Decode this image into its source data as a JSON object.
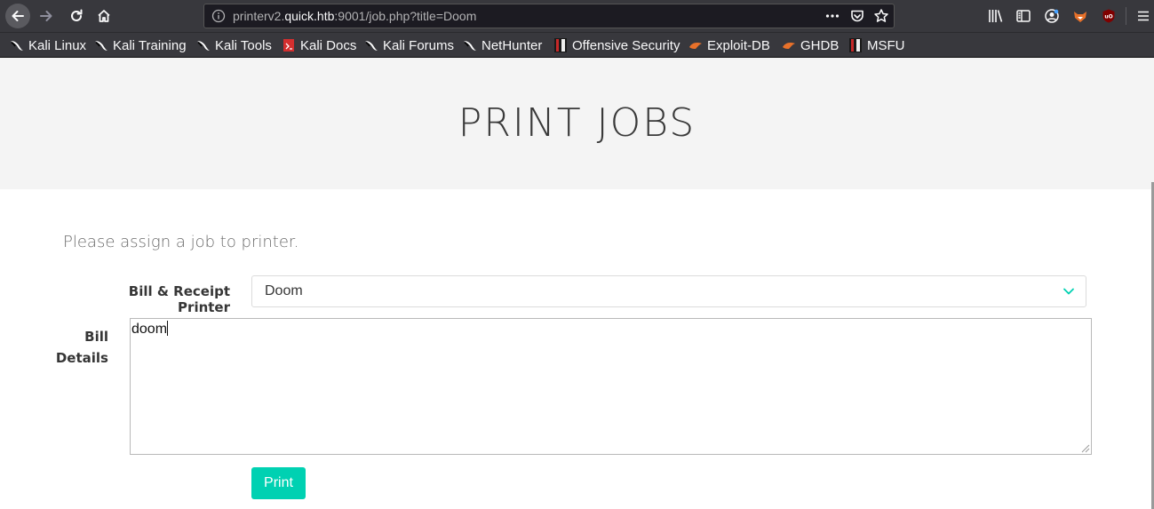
{
  "browser": {
    "url": {
      "prefix": "printerv2.",
      "host": "quick.htb",
      "suffix": ":9001/job.php?title=Doom"
    },
    "bookmarks": [
      {
        "label": "Kali Linux",
        "icon": "kali-dragon-icon"
      },
      {
        "label": "Kali Training",
        "icon": "kali-dragon-icon"
      },
      {
        "label": "Kali Tools",
        "icon": "kali-dragon-icon"
      },
      {
        "label": "Kali Docs",
        "icon": "kali-docs-icon"
      },
      {
        "label": "Kali Forums",
        "icon": "kali-dragon-icon"
      },
      {
        "label": "NetHunter",
        "icon": "kali-dragon-icon"
      },
      {
        "label": "Offensive Security",
        "icon": "offsec-icon"
      },
      {
        "label": "Exploit-DB",
        "icon": "exploitdb-icon"
      },
      {
        "label": "GHDB",
        "icon": "exploitdb-icon"
      },
      {
        "label": "MSFU",
        "icon": "offsec-icon"
      }
    ]
  },
  "page": {
    "title": "PRINT JOBS",
    "intro": "Please assign a job to printer.",
    "form": {
      "printer_label": "Bill & Receipt Printer",
      "printer_value": "Doom",
      "details_label_line1": "Bill",
      "details_label_line2": "Details",
      "details_value": "doom",
      "submit_label": "Print"
    }
  },
  "colors": {
    "accent": "#00d1b2",
    "chrome": "#38383d",
    "hero_bg": "#f4f4f4"
  }
}
